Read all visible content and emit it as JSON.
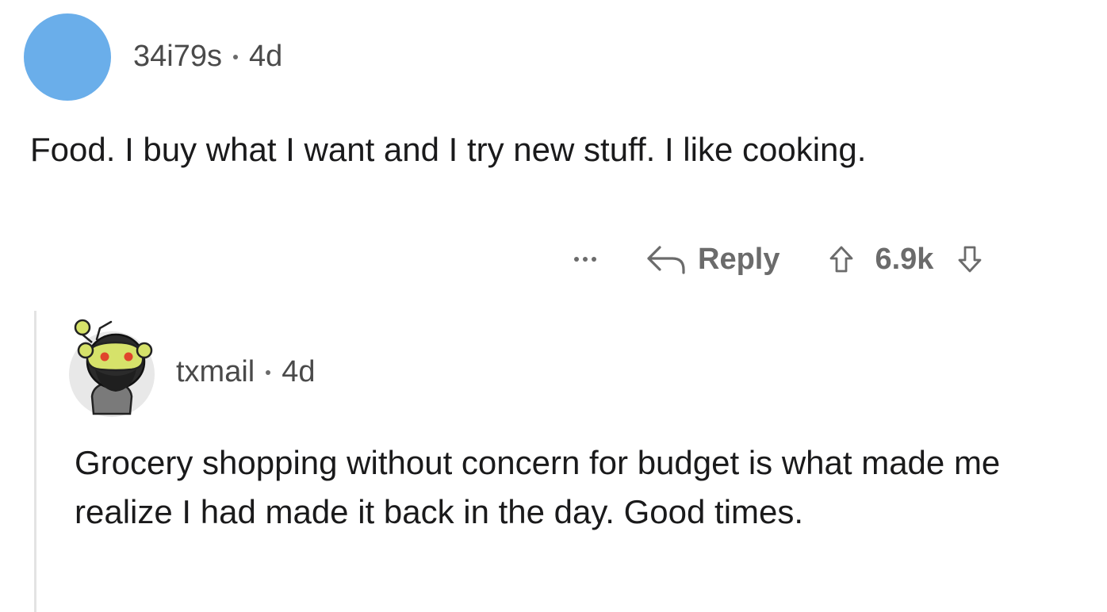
{
  "parent_comment": {
    "username": "34i79s",
    "age": "4d",
    "body": "Food. I buy what I want and I try new stuff. I like cooking.",
    "avatar_color": "#6aaeea"
  },
  "actions": {
    "more_icon": "ellipsis-icon",
    "reply_label": "Reply",
    "reply_icon": "reply-arrow-icon",
    "upvote_icon": "upvote-arrow-icon",
    "score": "6.9k",
    "downvote_icon": "downvote-arrow-icon"
  },
  "reply_comment": {
    "username": "txmail",
    "age": "4d",
    "body": "Grocery shopping without concern for budget is what made me realize I had made it back in the day. Good times.",
    "avatar_icon": "snoo-avatar-icon"
  }
}
